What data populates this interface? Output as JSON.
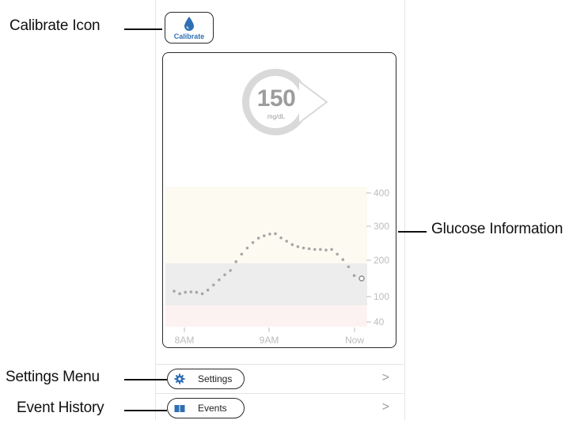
{
  "calibrate": {
    "label": "Calibrate",
    "icon": "water-drop-icon",
    "color": "#2f6fb3"
  },
  "glucose": {
    "value": "150",
    "unit": "mg/dL",
    "trend_icon": "trend-arrow-right-icon"
  },
  "chart_data": {
    "type": "scatter",
    "x_ticks": [
      "8AM",
      "9AM",
      "Now"
    ],
    "y_ticks": [
      "400",
      "300",
      "200",
      "100",
      "40"
    ],
    "ylim": [
      40,
      400
    ],
    "target_range": [
      80,
      200
    ],
    "colors": {
      "high_zone": "#fcfaf1",
      "target_zone": "#ededed",
      "low_zone": "#fdf2f2",
      "points": "#a6a6a6"
    },
    "x": [
      0,
      0.03,
      0.06,
      0.09,
      0.12,
      0.15,
      0.18,
      0.21,
      0.24,
      0.27,
      0.3,
      0.33,
      0.36,
      0.39,
      0.42,
      0.45,
      0.48,
      0.51,
      0.54,
      0.57,
      0.6,
      0.63,
      0.66,
      0.69,
      0.72,
      0.75,
      0.78,
      0.81,
      0.84,
      0.87,
      0.9,
      0.93,
      0.96,
      1.0
    ],
    "values": [
      115,
      108,
      112,
      113,
      112,
      108,
      118,
      132,
      146,
      160,
      172,
      196,
      218,
      236,
      252,
      265,
      272,
      277,
      278,
      266,
      256,
      246,
      240,
      236,
      234,
      232,
      232,
      230,
      232,
      218,
      202,
      182,
      158,
      150
    ]
  },
  "menu": {
    "settings": {
      "label": "Settings",
      "icon": "gear-icon",
      "chevron": ">"
    },
    "events": {
      "label": "Events",
      "icon": "book-icon",
      "chevron": ">"
    }
  },
  "callouts": {
    "calibrate": "Calibrate Icon",
    "glucose": "Glucose Information",
    "settings": "Settings Menu",
    "events": "Event History"
  }
}
